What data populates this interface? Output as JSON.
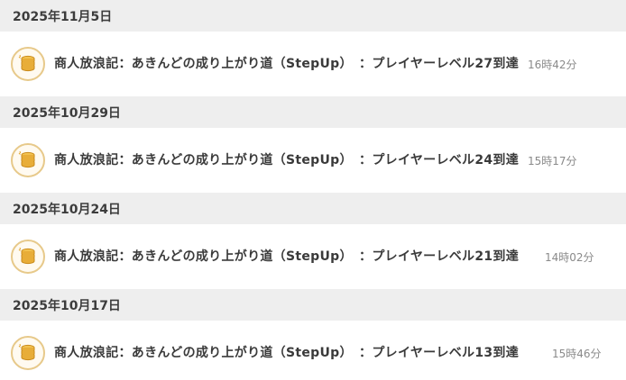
{
  "groups": [
    {
      "date": "2025年11月5日",
      "entry": {
        "icon": "coin-stack-icon",
        "title": "商人放浪記：あきんどの成り上がり道（StepUp）　：プレイヤーレベル27到達",
        "time": "16時42分"
      }
    },
    {
      "date": "2025年10月29日",
      "entry": {
        "icon": "coin-stack-icon",
        "title": "商人放浪記：あきんどの成り上がり道（StepUp）　：プレイヤーレベル24到達",
        "time": "15時17分"
      }
    },
    {
      "date": "2025年10月24日",
      "entry": {
        "icon": "coin-stack-icon",
        "title": "商人放浪記：あきんどの成り上がり道（StepUp）　：プレイヤーレベル21到達",
        "time": "14時02分"
      }
    },
    {
      "date": "2025年10月17日",
      "entry": {
        "icon": "coin-stack-icon",
        "title": "商人放浪記：あきんどの成り上がり道（StepUp）　：プレイヤーレベル13到達",
        "time": "15時46分"
      }
    }
  ],
  "colors": {
    "header_bg": "#eeeeee",
    "coin": "#e2a52f",
    "text": "#3a3a3a",
    "time": "#8a8a8a"
  }
}
